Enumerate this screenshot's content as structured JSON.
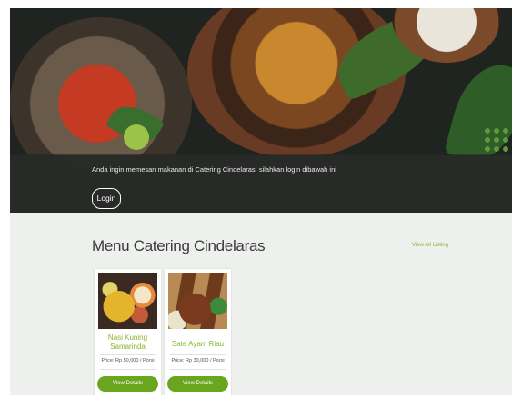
{
  "hero": {
    "message": "Anda ingin memesan makanan di Catering Cindelaras, silahkan login dibawah ini",
    "login_label": "Login"
  },
  "menu": {
    "title": "Menu Catering Cindelaras",
    "view_all_label": "View All Listing",
    "items": [
      {
        "name_line1": "Nasi Kuning",
        "name_line2": "Samarinda",
        "price": "Price: Rp 50,000 / Porsi",
        "button_label": "View Details"
      },
      {
        "name": "Sate Ayam Riau",
        "price": "Price: Rp 30,000 / Porsi",
        "button_label": "View Details"
      }
    ]
  },
  "colors": {
    "accent_green": "#6aa51f",
    "link_green": "#8ab52f",
    "hero_bar": "#2a2d2a"
  }
}
